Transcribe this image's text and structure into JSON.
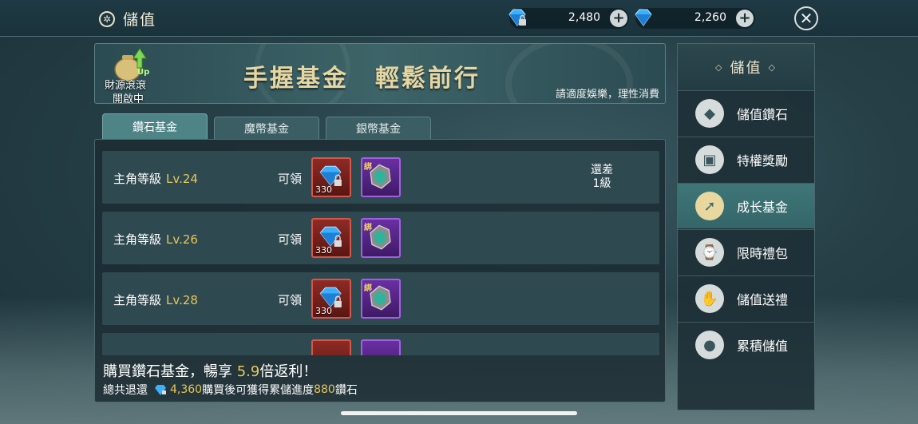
{
  "header": {
    "title": "儲值",
    "currencies": [
      {
        "icon": "locked-diamond-icon",
        "amount": "2,480",
        "plus": "+"
      },
      {
        "icon": "diamond-icon",
        "amount": "2,260",
        "plus": "+"
      }
    ],
    "close": "✕"
  },
  "banner": {
    "bag_line1": "財源滾滾",
    "bag_line2": "開啟中",
    "bag_badge": "Up",
    "title": "手握基金　輕鬆前行",
    "note": "請適度娛樂，理性消費"
  },
  "tabs": [
    {
      "label": "鑽石基金",
      "active": true
    },
    {
      "label": "魔幣基金",
      "active": false
    },
    {
      "label": "銀幣基金",
      "active": false
    }
  ],
  "rows": [
    {
      "label": "主角等級",
      "level": "Lv.24",
      "claim": "可領",
      "reward1_qty": "330",
      "reward2_tag": "綁",
      "status_line1": "還差",
      "status_line2": "1級"
    },
    {
      "label": "主角等級",
      "level": "Lv.26",
      "claim": "可領",
      "reward1_qty": "330",
      "reward2_tag": "綁",
      "status_line1": "",
      "status_line2": ""
    },
    {
      "label": "主角等級",
      "level": "Lv.28",
      "claim": "可領",
      "reward1_qty": "330",
      "reward2_tag": "綁",
      "status_line1": "",
      "status_line2": ""
    }
  ],
  "summary": {
    "line1_pre": "購買鑽石基金，暢享 ",
    "line1_mult": "5.9",
    "line1_post": "倍返利！",
    "line2_pre": "總共退還",
    "line2_amount": "4,360",
    "line2_mid": " 購買後可獲得累儲進度",
    "line2_progress": "880",
    "line2_post": "鑽石"
  },
  "side_menu": {
    "title": "儲值",
    "items": [
      {
        "label": "儲值鑽石",
        "icon": "diamond-icon",
        "active": false
      },
      {
        "label": "特權獎勵",
        "icon": "treasure-chest-icon",
        "active": false
      },
      {
        "label": "成长基金",
        "icon": "growth-arrow-icon",
        "active": true
      },
      {
        "label": "限時禮包",
        "icon": "gift-clock-icon",
        "active": false
      },
      {
        "label": "儲值送禮",
        "icon": "gift-hand-icon",
        "active": false
      },
      {
        "label": "累積儲值",
        "icon": "piggy-bank-icon",
        "active": false
      }
    ]
  },
  "colors": {
    "accent_gold": "#e6c75a",
    "active_teal": "#3f7678",
    "reward_red": "#8e2b25",
    "reward_purple": "#6a2fa3"
  }
}
